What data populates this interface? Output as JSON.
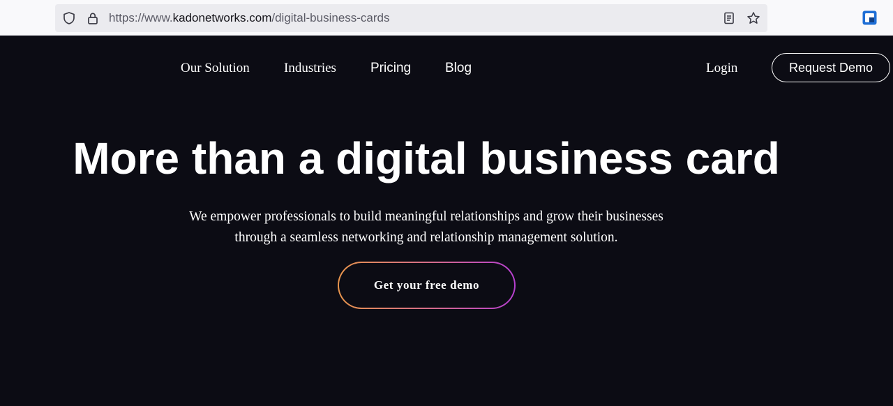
{
  "browser": {
    "url_prefix": "https://www.",
    "url_domain": "kadonetworks.com",
    "url_path": "/digital-business-cards",
    "icons": [
      "shield-icon",
      "lock-icon",
      "reader-mode-icon",
      "bookmark-star-icon",
      "extension-icon"
    ]
  },
  "nav": {
    "links": [
      "Our Solution",
      "Industries",
      "Pricing",
      "Blog"
    ],
    "login": "Login",
    "request_demo": "Request Demo"
  },
  "hero": {
    "title": "More than a digital business card",
    "subtitle_line1": "We empower professionals to build meaningful relationships and grow their businesses",
    "subtitle_line2": "through a seamless networking and relationship management solution.",
    "cta": "Get your free demo"
  },
  "colors": {
    "page_bg": "#0c0c14",
    "text": "#ffffff",
    "cta_gradient_start": "#e8954c",
    "cta_gradient_end": "#b63fd0"
  }
}
